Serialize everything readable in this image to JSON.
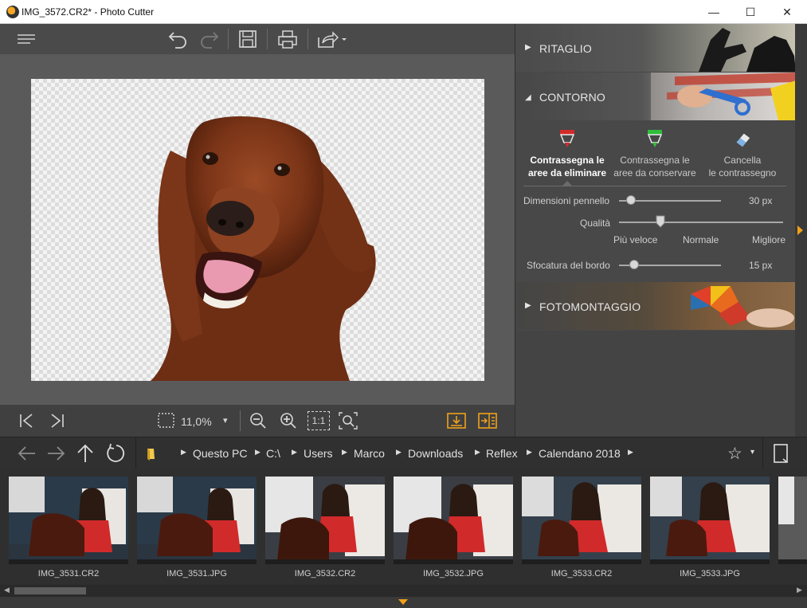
{
  "window": {
    "title": "IMG_3572.CR2* - Photo Cutter",
    "minimize": "—",
    "maximize": "☐",
    "close": "✕"
  },
  "toolbar": {
    "icons": [
      "menu-icon",
      "undo-icon",
      "redo-icon",
      "save-icon",
      "print-icon",
      "share-icon"
    ]
  },
  "canvasbar": {
    "zoom": "11,0%",
    "zoom_dropdown": "▾",
    "one_to_one": "1:1"
  },
  "panel": {
    "ritaglio": "RITAGLIO",
    "contorno": "CONTORNO",
    "fotomontaggio": "FOTOMONTAGGIO",
    "tools": [
      {
        "line1": "Contrassegna le",
        "line2": "aree da eliminare",
        "color": "#d62a2a"
      },
      {
        "line1": "Contrassegna le",
        "line2": "aree da conservare",
        "color": "#2fbf3a"
      },
      {
        "line1": "Cancella",
        "line2": "le contrassegno",
        "color": "#e9e9e9"
      }
    ],
    "brush": {
      "label": "Dimensioni pennello",
      "value": "30 px",
      "level": 0.12
    },
    "quality": {
      "label": "Qualità",
      "opt1": "Più veloce",
      "opt2": "Normale",
      "opt3": "Migliore",
      "level": 0.25
    },
    "blur": {
      "label": "Sfocatura del bordo",
      "value": "15 px",
      "level": 0.15
    }
  },
  "nav": {
    "crumbs": [
      "Questo PC",
      "C:\\",
      "Users",
      "Marco",
      "Downloads",
      "Reflex",
      "Calendano 2018"
    ],
    "star": "☆",
    "star_dd": "▾"
  },
  "thumbs": [
    "IMG_3531.CR2",
    "IMG_3531.JPG",
    "IMG_3532.CR2",
    "IMG_3532.JPG",
    "IMG_3533.CR2",
    "IMG_3533.JPG"
  ],
  "colors": {
    "accent": "#f0a11a",
    "panel": "#484848",
    "canvas": "#5a5a5a"
  }
}
